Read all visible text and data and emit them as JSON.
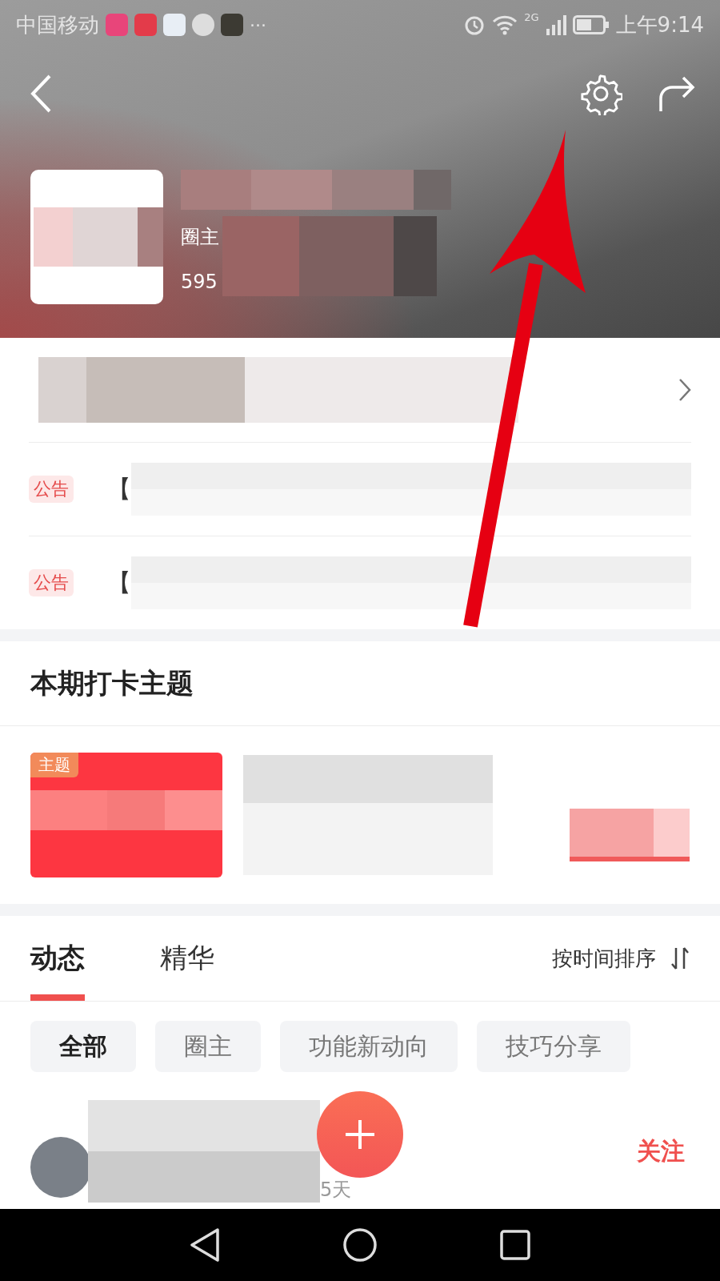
{
  "status_bar": {
    "carrier": "中国移动",
    "more": "···",
    "network": "2G",
    "time": "上午9:14"
  },
  "header": {
    "owner_label": "圈主",
    "count": "595"
  },
  "notices": [
    {
      "tag": "公告",
      "text": "【"
    },
    {
      "tag": "公告",
      "text": "【"
    }
  ],
  "theme_section": {
    "title": "本期打卡主题",
    "badge": "主题"
  },
  "tabs": [
    {
      "label": "动态",
      "selected": true
    },
    {
      "label": "精华",
      "selected": false
    }
  ],
  "sort": {
    "label": "按时间排序"
  },
  "filters": [
    {
      "label": "全部",
      "selected": true
    },
    {
      "label": "圈主",
      "selected": false
    },
    {
      "label": "功能新动向",
      "selected": false
    },
    {
      "label": "技巧分享",
      "selected": false
    }
  ],
  "post": {
    "time": "5天",
    "follow": "关注"
  }
}
